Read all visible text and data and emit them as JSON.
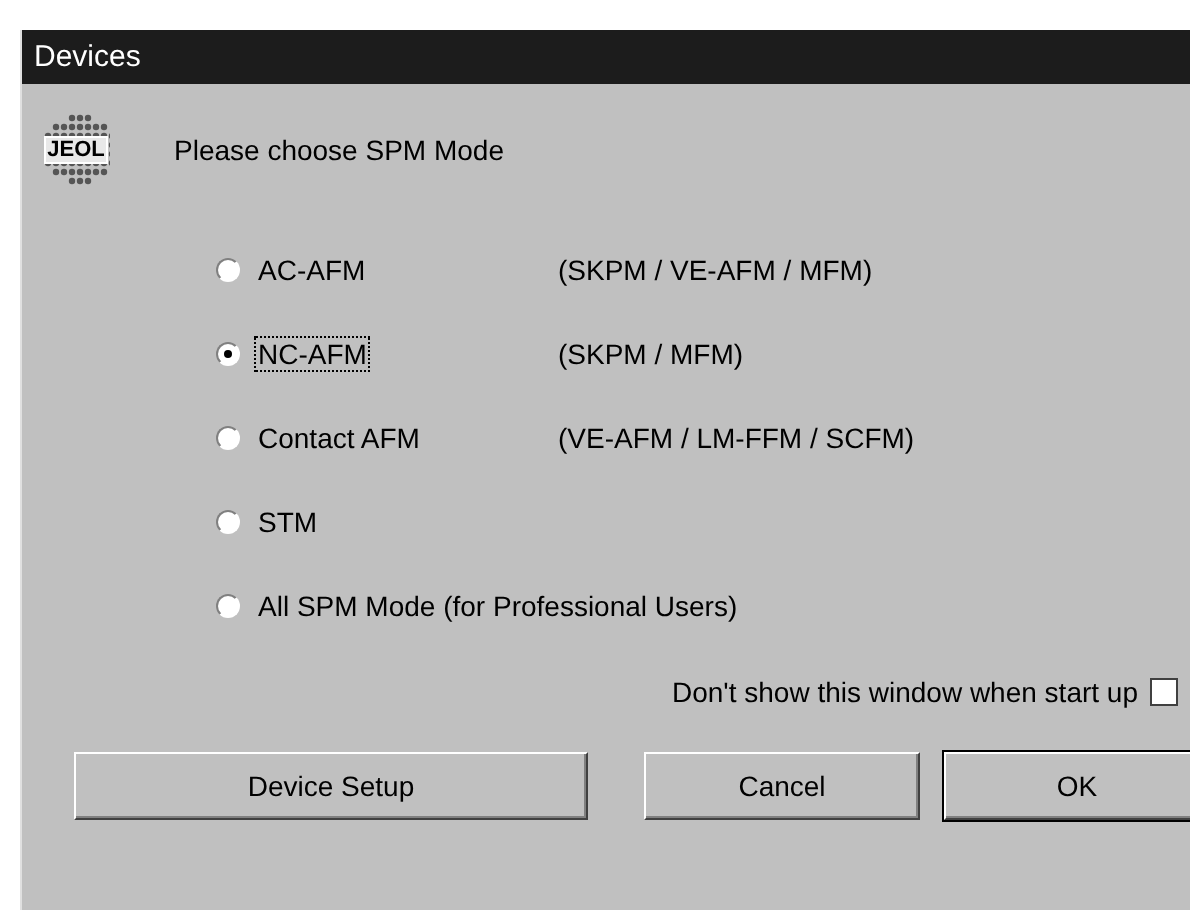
{
  "window": {
    "title": "Devices"
  },
  "logo": {
    "text": "JEOL"
  },
  "prompt": "Please choose SPM Mode",
  "modes": [
    {
      "label": "AC-AFM",
      "description": "(SKPM / VE-AFM / MFM)",
      "selected": false,
      "focused": false
    },
    {
      "label": "NC-AFM",
      "description": "(SKPM / MFM)",
      "selected": true,
      "focused": true
    },
    {
      "label": "Contact AFM",
      "description": "(VE-AFM / LM-FFM / SCFM)",
      "selected": false,
      "focused": false
    },
    {
      "label": "STM",
      "selected": false,
      "focused": false
    },
    {
      "label": "All SPM Mode (for Professional Users)",
      "selected": false,
      "focused": false
    }
  ],
  "startup_checkbox": {
    "label": "Don't show this window when start up",
    "checked": false
  },
  "buttons": [
    {
      "label": "Device Setup",
      "default": false
    },
    {
      "label": "Cancel",
      "default": false
    },
    {
      "label": "OK",
      "default": true
    }
  ]
}
